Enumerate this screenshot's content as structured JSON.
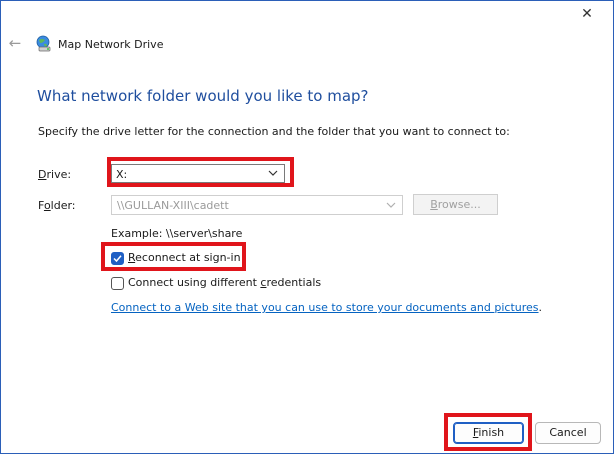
{
  "window": {
    "title": "Map Network Drive",
    "close_glyph": "✕",
    "back_glyph": "←"
  },
  "heading": "What network folder would you like to map?",
  "intro": "Specify the drive letter for the connection and the folder that you want to connect to:",
  "drive": {
    "label_pre": "",
    "label_key": "D",
    "label_post": "rive:",
    "value": "X:"
  },
  "folder": {
    "label_pre": "F",
    "label_key": "o",
    "label_post": "lder:",
    "value": "\\\\GULLAN-XIII\\cadett"
  },
  "browse": {
    "label_key": "B",
    "label_post": "rowse..."
  },
  "example": "Example: \\\\server\\share",
  "reconnect": {
    "label_key": "R",
    "label_post": "econnect at sign-in",
    "checked": true
  },
  "credentials": {
    "label_pre": "Connect using different ",
    "label_key": "c",
    "label_post": "redentials",
    "checked": false
  },
  "link": {
    "text": "Connect to a Web site that you can use to store your documents and pictures",
    "suffix": "."
  },
  "buttons": {
    "finish_key": "F",
    "finish_post": "inish",
    "cancel": "Cancel"
  },
  "colors": {
    "heading": "#1f4e9e",
    "accent": "#1f5fc4",
    "highlight": "#e0151b",
    "link": "#0563c1"
  }
}
